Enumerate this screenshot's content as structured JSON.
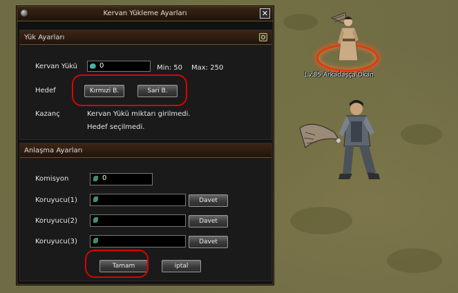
{
  "dialog": {
    "title": "Kervan Yükleme Ayarları",
    "close_glyph": "✕"
  },
  "load_section": {
    "heading": "Yük Ayarları",
    "caravan_load_label": "Kervan Yükü",
    "caravan_load_value": "0",
    "min_text": "Min: 50",
    "max_text": "Max: 250",
    "target_label": "Hedef",
    "red_button": "Kırmızi B.",
    "yellow_button": "Sari B.",
    "earnings_label": "Kazanç",
    "earnings_msg1": "Kervan Yükü miktarı girilmedi.",
    "earnings_msg2": "Hedef seçilmedi."
  },
  "deal_section": {
    "heading": "Anlaşma Ayarları",
    "commission_label": "Komisyon",
    "commission_value": "0",
    "guards": [
      {
        "label": "Koruyucu(1)",
        "value": "",
        "button": "Davet"
      },
      {
        "label": "Koruyucu(2)",
        "value": "",
        "button": "Davet"
      },
      {
        "label": "Koruyucu(3)",
        "value": "",
        "button": "Davet"
      }
    ],
    "ok_button": "Tamam",
    "cancel_button": "iptal"
  },
  "world": {
    "npc_name": "Lv.85 Arkadaşça Okan"
  },
  "colors": {
    "annotation": "#e00000",
    "panel_header": "#3c2616",
    "npc_ring": "#e23a10"
  }
}
